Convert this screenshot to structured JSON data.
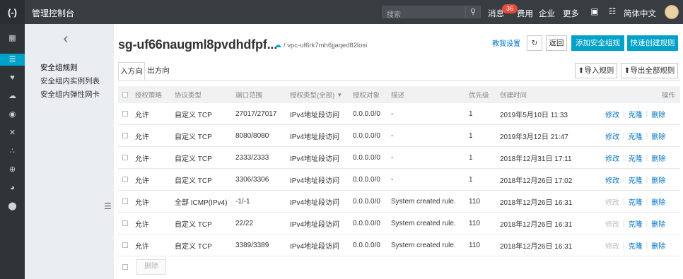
{
  "topbar": {
    "logo": "(-)",
    "title": "管理控制台",
    "search_placeholder": "搜索",
    "nav": [
      "消息",
      "费用",
      "企业",
      "更多",
      "简体中文"
    ],
    "message_count": "36"
  },
  "subnav": {
    "items": [
      "安全组规则",
      "安全组内实例列表",
      "安全组内弹性网卡"
    ]
  },
  "header": {
    "sg_id": "sg-uf66naugml8pvdhdfpf...",
    "vpc_id": "/ vpc-uf6rk7mh6jjaqed82losi",
    "teach_link": "教我设置",
    "back_label": "返回",
    "add_rule_label": "添加安全组规则",
    "quick_rule_label": "快速创建规则",
    "import_label": "导入规则",
    "export_label": "导出全部规则"
  },
  "tabs": [
    "入方向",
    "出方向"
  ],
  "table": {
    "columns": [
      "授权策略",
      "协议类型",
      "端口范围",
      "授权类型(全部)",
      "授权对象",
      "描述",
      "优先级",
      "创建时间",
      "操作"
    ],
    "rows": [
      {
        "policy": "允许",
        "protocol": "自定义 TCP",
        "port": "27017/27017",
        "auth_type": "IPv4地址段访问",
        "object": "0.0.0.0/0",
        "desc": "-",
        "priority": "1",
        "time": "2019年5月10日 11:33",
        "edit": "修改",
        "clone": "克隆",
        "del": "删除",
        "edit_enabled": true
      },
      {
        "policy": "允许",
        "protocol": "自定义 TCP",
        "port": "8080/8080",
        "auth_type": "IPv4地址段访问",
        "object": "0.0.0.0/0",
        "desc": "-",
        "priority": "1",
        "time": "2019年3月12日 21:47",
        "edit": "修改",
        "clone": "克隆",
        "del": "删除",
        "edit_enabled": true
      },
      {
        "policy": "允许",
        "protocol": "自定义 TCP",
        "port": "2333/2333",
        "auth_type": "IPv4地址段访问",
        "object": "0.0.0.0/0",
        "desc": "-",
        "priority": "1",
        "time": "2018年12月31日 17:11",
        "edit": "修改",
        "clone": "克隆",
        "del": "删除",
        "edit_enabled": true
      },
      {
        "policy": "允许",
        "protocol": "自定义 TCP",
        "port": "3306/3306",
        "auth_type": "IPv4地址段访问",
        "object": "0.0.0.0/0",
        "desc": "-",
        "priority": "1",
        "time": "2018年12月26日 17:02",
        "edit": "修改",
        "clone": "克隆",
        "del": "删除",
        "edit_enabled": true
      },
      {
        "policy": "允许",
        "protocol": "全部 ICMP(IPv4)",
        "port": "-1/-1",
        "auth_type": "IPv4地址段访问",
        "object": "0.0.0.0/0",
        "desc": "System created rule.",
        "priority": "110",
        "time": "2018年12月26日 16:31",
        "edit": "修改",
        "clone": "克隆",
        "del": "删除",
        "edit_enabled": false
      },
      {
        "policy": "允许",
        "protocol": "自定义 TCP",
        "port": "22/22",
        "auth_type": "IPv4地址段访问",
        "object": "0.0.0.0/0",
        "desc": "System created rule.",
        "priority": "110",
        "time": "2018年12月26日 16:31",
        "edit": "修改",
        "clone": "克隆",
        "del": "删除",
        "edit_enabled": false
      },
      {
        "policy": "允许",
        "protocol": "自定义 TCP",
        "port": "3389/3389",
        "auth_type": "IPv4地址段访问",
        "object": "0.0.0.0/0",
        "desc": "System created rule.",
        "priority": "110",
        "time": "2018年12月26日 16:31",
        "edit": "修改",
        "clone": "克隆",
        "del": "删除",
        "edit_enabled": false
      }
    ]
  },
  "footer": {
    "delete_label": "删除"
  },
  "colors": {
    "accent": "#00a2ca",
    "link": "#0073c7",
    "topbar": "#373d41",
    "badge": "#e64b3b"
  }
}
